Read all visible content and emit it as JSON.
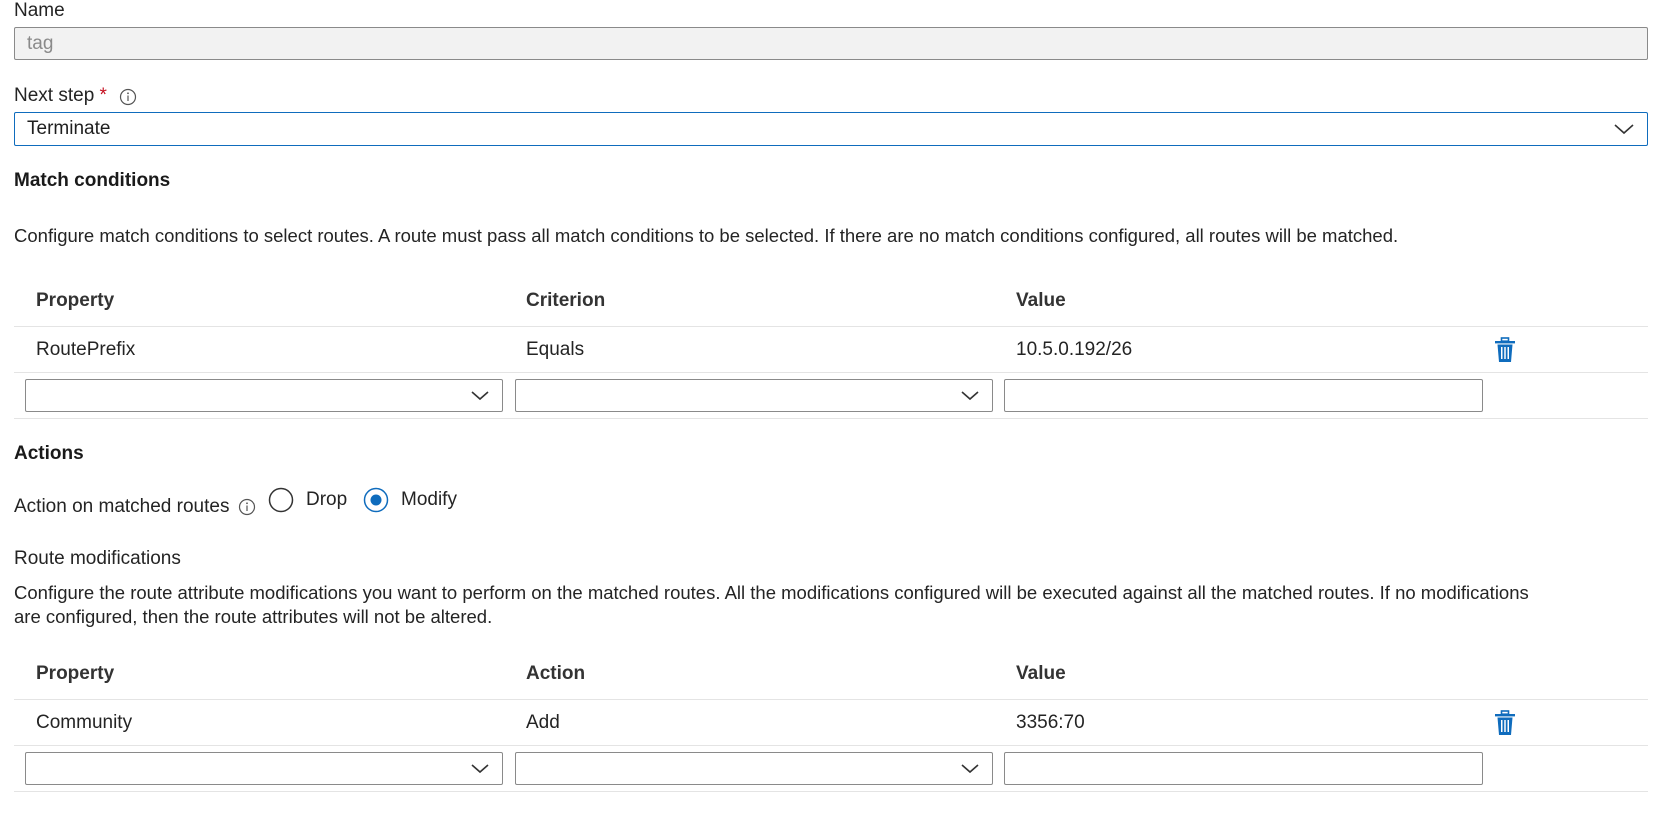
{
  "name": {
    "label": "Name",
    "value": "tag"
  },
  "next_step": {
    "label": "Next step",
    "required_mark": "*",
    "value": "Terminate"
  },
  "match_conditions": {
    "heading": "Match conditions",
    "description": "Configure match conditions to select routes. A route must pass all match conditions to be selected. If there are no match conditions configured, all routes will be matched.",
    "columns": [
      "Property",
      "Criterion",
      "Value"
    ],
    "rows": [
      {
        "property": "RoutePrefix",
        "criterion": "Equals",
        "value": "10.5.0.192/26"
      }
    ]
  },
  "actions": {
    "heading": "Actions",
    "action_label": "Action on matched routes",
    "options": [
      "Drop",
      "Modify"
    ],
    "selected": "Modify"
  },
  "route_modifications": {
    "heading": "Route modifications",
    "description_line1": "Configure the route attribute modifications you want to perform on the matched routes. All the modifications configured will be executed against all the matched routes. If no modifications",
    "description_line2": "are configured, then the route attributes will not be altered.",
    "columns": [
      "Property",
      "Action",
      "Value"
    ],
    "rows": [
      {
        "property": "Community",
        "action": "Add",
        "value": "3356:70"
      }
    ]
  },
  "colors": {
    "accent": "#0f6cbd",
    "required": "#c50f1f",
    "border": "#8a8a8a",
    "divider": "#e4e4e4"
  },
  "icons": {
    "info": "info-icon",
    "chevron": "chevron-down-icon",
    "delete": "trash-icon"
  }
}
